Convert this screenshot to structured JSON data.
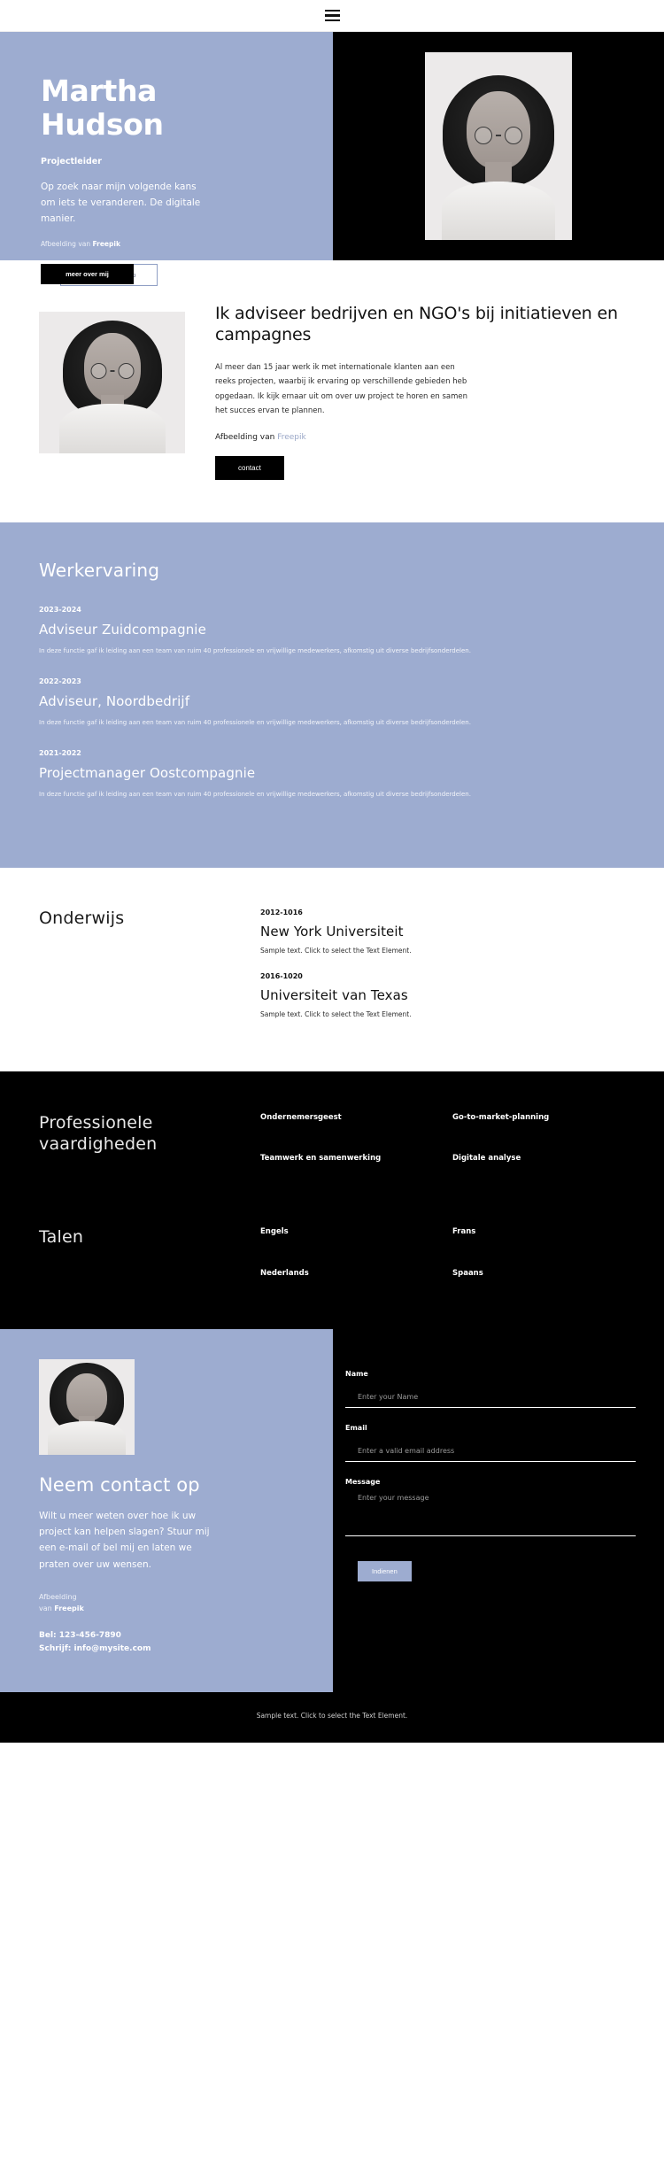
{
  "nav": {
    "menu_icon": "hamburger-menu-icon"
  },
  "hero": {
    "title_line1": "Martha",
    "title_line2": "Hudson",
    "subtitle": "Projectleider",
    "description": "Op zoek naar mijn volgende kans om iets te veranderen. De digitale manier.",
    "credit_prefix": "Afbeelding van ",
    "credit_source": "Freepik",
    "primary_button": "meer over mij",
    "secondary_button": "contact met mij op",
    "image_alt": "portrait-photo"
  },
  "about": {
    "heading": "Ik adviseer bedrijven en NGO's bij initiatieven en campagnes",
    "paragraph": "Al meer dan 15 jaar werk ik met internationale klanten aan een reeks projecten, waarbij ik ervaring op verschillende gebieden heb opgedaan. Ik kijk ernaar uit om over uw project te horen en samen het succes ervan te plannen.",
    "credit_prefix": "Afbeelding van ",
    "credit_source": "Freepik",
    "button": "contact",
    "image_alt": "thinking-portrait-photo"
  },
  "work": {
    "heading": "Werkervaring",
    "jobs": [
      {
        "date": "2023-2024",
        "title": "Adviseur Zuidcompagnie",
        "description": "In deze functie gaf ik leiding aan een team van ruim 40 professionele en vrijwillige medewerkers, afkomstig uit diverse bedrijfsonderdelen."
      },
      {
        "date": "2022-2023",
        "title": "Adviseur, Noordbedrijf",
        "description": "In deze functie gaf ik leiding aan een team van ruim 40 professionele en vrijwillige medewerkers, afkomstig uit diverse bedrijfsonderdelen."
      },
      {
        "date": "2021-2022",
        "title": "Projectmanager Oostcompagnie",
        "description": "In deze functie gaf ik leiding aan een team van ruim 40 professionele en vrijwillige medewerkers, afkomstig uit diverse bedrijfsonderdelen."
      }
    ]
  },
  "education": {
    "heading": "Onderwijs",
    "items": [
      {
        "date": "2012-1016",
        "school": "New York Universiteit",
        "note": "Sample text. Click to select the Text Element."
      },
      {
        "date": "2016-1020",
        "school": "Universiteit van Texas",
        "note": "Sample text. Click to select the Text Element."
      }
    ]
  },
  "skills": {
    "heading_line1": "Professionele",
    "heading_line2": "vaardigheden",
    "items": [
      "Ondernemersgeest",
      "Go-to-market-planning",
      "Teamwerk en samenwerking",
      "Digitale analyse"
    ]
  },
  "languages": {
    "heading": "Talen",
    "items": [
      "Engels",
      "Frans",
      "Nederlands",
      "Spaans"
    ]
  },
  "contact": {
    "heading": "Neem contact op",
    "description": "Wilt u meer weten over hoe ik uw project kan helpen slagen? Stuur mij een e-mail of bel mij en laten we praten over uw wensen.",
    "credit_line1": "Afbeelding",
    "credit_prefix": "van ",
    "credit_source": "Freepik",
    "phone": "Bel: 123-456-7890",
    "email": "Schrijf: info@mysite.com",
    "image_alt": "smiling-portrait-photo",
    "form": {
      "name_label": "Name",
      "name_placeholder": "Enter your Name",
      "email_label": "Email",
      "email_placeholder": "Enter a valid email address",
      "message_label": "Message",
      "message_placeholder": "Enter your message",
      "submit_label": "Indienen"
    }
  },
  "footer": {
    "text": "Sample text. Click to select the Text Element."
  },
  "colors": {
    "periwinkle": "#9dacd0",
    "black": "#000000",
    "white": "#ffffff",
    "link": "#9aa7c7"
  }
}
